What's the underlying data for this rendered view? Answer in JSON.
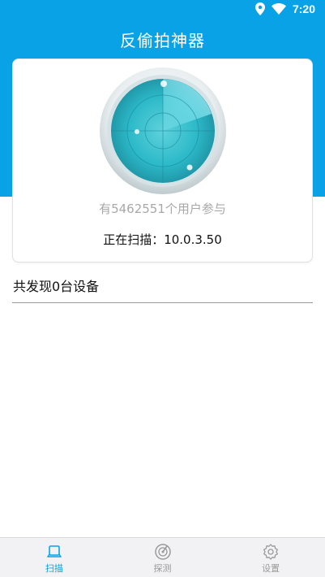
{
  "status_bar": {
    "time": "7:20",
    "icons": [
      "location-icon",
      "wifi-icon"
    ]
  },
  "header": {
    "title": "反偷拍神器"
  },
  "radar_card": {
    "users_text": "有5462551个用户参与",
    "scanning_text": "正在扫描：10.0.3.50"
  },
  "results": {
    "found_text": "共发现0台设备"
  },
  "bottom_nav": {
    "items": [
      {
        "label": "扫描",
        "icon": "scan-icon",
        "active": true
      },
      {
        "label": "探测",
        "icon": "detect-icon",
        "active": false
      },
      {
        "label": "设置",
        "icon": "settings-icon",
        "active": false
      }
    ]
  },
  "colors": {
    "primary": "#0aa2e6",
    "inactive": "#9a9a9a",
    "radar": "#2cc9d8"
  }
}
